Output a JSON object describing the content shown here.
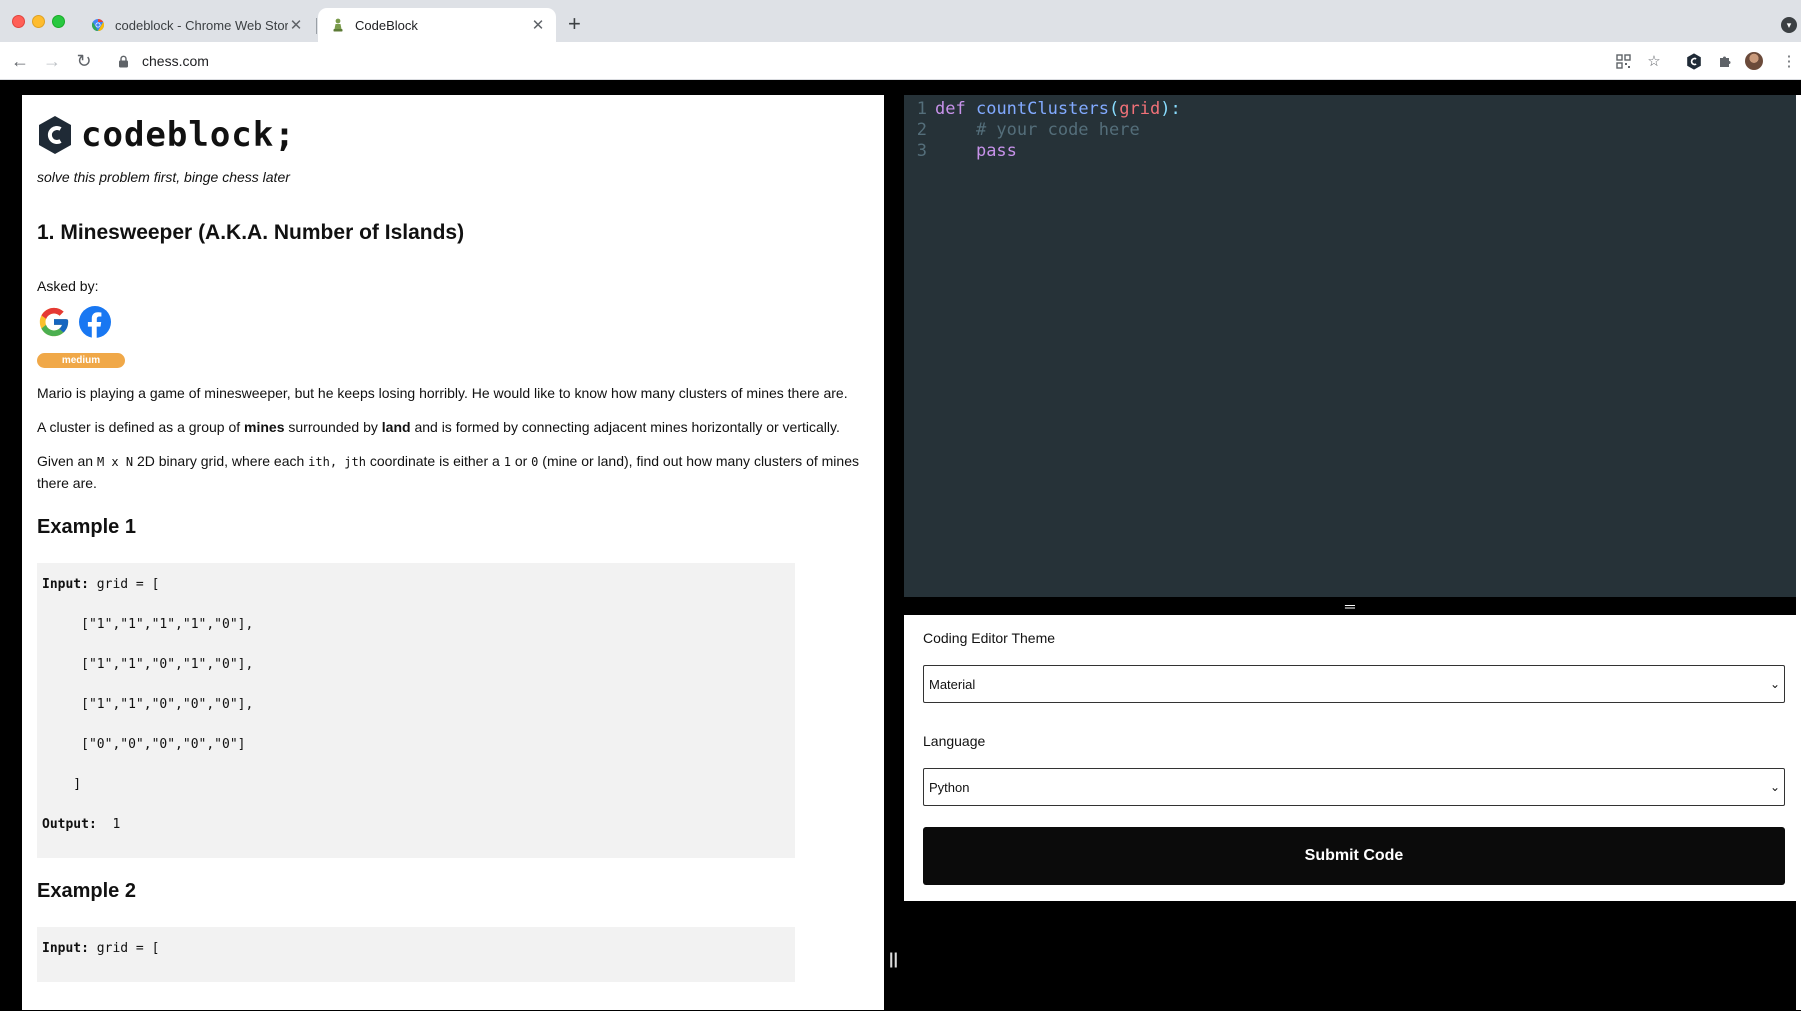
{
  "browser": {
    "tabs": [
      {
        "title": "codeblock - Chrome Web Store",
        "active": false
      },
      {
        "title": "CodeBlock",
        "active": true
      }
    ],
    "url": "chess.com"
  },
  "header": {
    "logo_text": "codeblock;",
    "tagline": "solve this problem first, binge chess later"
  },
  "problem": {
    "title": "1. Minesweeper (A.K.A. Number of Islands)",
    "asked_by_label": "Asked by:",
    "companies": [
      "google-icon",
      "facebook-icon"
    ],
    "difficulty": "medium",
    "difficulty_color": "#f0a848",
    "p1": "Mario is playing a game of minesweeper, but he keeps losing horribly. He would like to know how many clusters of mines there are.",
    "p2": {
      "a": "A cluster is defined as a group of ",
      "b": "mines",
      "c": " surrounded by ",
      "d": "land",
      "e": " and is formed by connecting adjacent mines horizontally or vertically."
    },
    "p3": {
      "a": "Given an ",
      "b": "M x N",
      "c": " 2D binary grid, where each ",
      "d": "ith, jth",
      "e": " coordinate is either a ",
      "f": "1",
      "g": " or ",
      "h": "0",
      "i": " (mine or land), find out how many clusters of mines there are."
    }
  },
  "examples": [
    {
      "title": "Example 1",
      "input_label": "Input:",
      "input_head": " grid = [",
      "rows": [
        "     [\"1\",\"1\",\"1\",\"1\",\"0\"],",
        "     [\"1\",\"1\",\"0\",\"1\",\"0\"],",
        "     [\"1\",\"1\",\"0\",\"0\",\"0\"],",
        "     [\"0\",\"0\",\"0\",\"0\",\"0\"]",
        "    ]"
      ],
      "output_label": "Output:",
      "output_value": "  1"
    },
    {
      "title": "Example 2",
      "input_label": "Input:",
      "input_head": " grid = ["
    }
  ],
  "editor": {
    "lines": [
      {
        "n": "1",
        "tokens": [
          [
            "kw",
            "def"
          ],
          [
            "plain",
            " "
          ],
          [
            "fn",
            "countClusters"
          ],
          [
            "punct",
            "("
          ],
          [
            "param",
            "grid"
          ],
          [
            "punct",
            "):"
          ]
        ]
      },
      {
        "n": "2",
        "tokens": [
          [
            "plain",
            "    "
          ],
          [
            "cm",
            "# your code here"
          ]
        ]
      },
      {
        "n": "3",
        "tokens": [
          [
            "plain",
            "    "
          ],
          [
            "kw",
            "pass"
          ]
        ]
      }
    ],
    "background": "#263238"
  },
  "settings": {
    "theme_label": "Coding Editor Theme",
    "theme_value": "Material",
    "language_label": "Language",
    "language_value": "Python",
    "submit_label": "Submit Code"
  }
}
